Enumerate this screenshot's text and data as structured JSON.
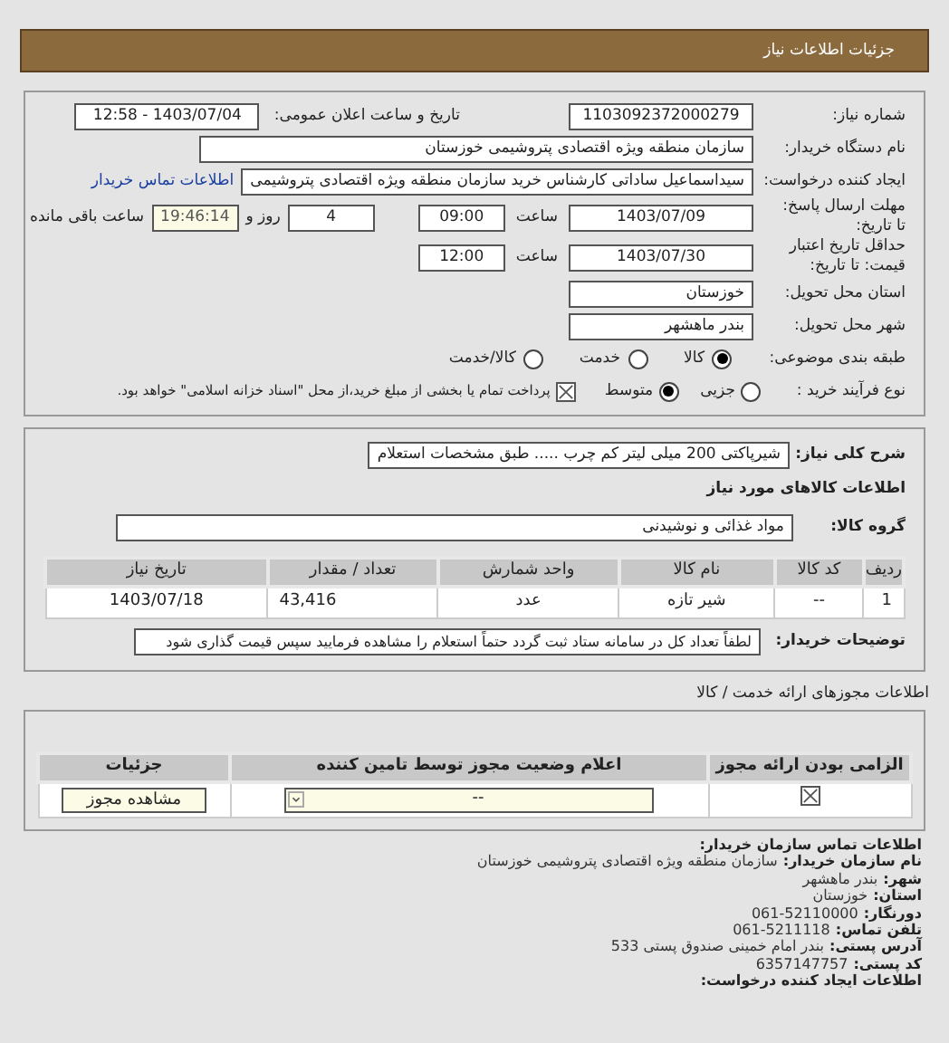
{
  "header": {
    "title": "جزئیات اطلاعات نیاز"
  },
  "need_number": {
    "label": "شماره نیاز:",
    "value": "1103092372000279"
  },
  "announce": {
    "label": "تاریخ و ساعت اعلان عمومی:",
    "value": "1403/07/04 - 12:58"
  },
  "buyer_org": {
    "label": "نام دستگاه خریدار:",
    "value": "سازمان منطقه ویژه اقتصادی پتروشیمی خوزستان"
  },
  "requester": {
    "label": "ایجاد کننده درخواست:",
    "value": "سیداسماعیل ساداتی کارشناس خرید سازمان منطقه ویژه اقتصادی پتروشیمی",
    "link": "اطلاعات تماس خریدار"
  },
  "deadline": {
    "label": "مهلت ارسال پاسخ: تا تاریخ:",
    "date": "1403/07/09",
    "time_label": "ساعت",
    "time": "09:00",
    "days": "4",
    "days_label": "روز و",
    "remaining": "19:46:14",
    "remaining_label": "ساعت باقی مانده"
  },
  "validity": {
    "label": "حداقل تاریخ اعتبار قیمت: تا تاریخ:",
    "date": "1403/07/30",
    "time_label": "ساعت",
    "time": "12:00"
  },
  "province": {
    "label": "استان محل تحویل:",
    "value": "خوزستان"
  },
  "city": {
    "label": "شهر محل تحویل:",
    "value": "بندر ماهشهر"
  },
  "category": {
    "label": "طبقه بندی موضوعی:",
    "options": [
      {
        "label": "کالا",
        "selected": true
      },
      {
        "label": "خدمت",
        "selected": false
      },
      {
        "label": "کالا/خدمت",
        "selected": false
      }
    ]
  },
  "process": {
    "label": "نوع فرآیند خرید :",
    "options": [
      {
        "label": "جزیی",
        "selected": false
      },
      {
        "label": "متوسط",
        "selected": true
      }
    ],
    "payment": {
      "checked": true,
      "text": "پرداخت تمام یا بخشی از مبلغ خرید،از محل \"اسناد خزانه اسلامی\" خواهد بود."
    }
  },
  "description": {
    "label": "شرح کلی نیاز:",
    "value": "شیرپاکتی 200 میلی لیتر کم چرب ..... طبق مشخصات استعلام"
  },
  "goods_title": "اطلاعات کالاهای مورد نیاز",
  "goods_group": {
    "label": "گروه کالا:",
    "value": "مواد غذائی و نوشیدنی"
  },
  "goods_table": {
    "columns": [
      "ردیف",
      "کد کالا",
      "نام کالا",
      "واحد شمارش",
      "تعداد / مقدار",
      "تاریخ نیاز"
    ],
    "rows": [
      [
        "1",
        "--",
        "شیر تازه",
        "عدد",
        "43,416",
        "1403/07/18"
      ]
    ]
  },
  "buyer_notes": {
    "label": "توضیحات خریدار:",
    "value": "لطفاً تعداد کل در سامانه ستاد ثبت گردد حتماً استعلام را مشاهده فرمایید سپس قیمت گذاری شود"
  },
  "license_title": "اطلاعات مجوزهای ارائه خدمت / کالا",
  "license_table": {
    "columns": [
      "الزامی بودن ارائه مجوز",
      "اعلام وضعیت مجوز توسط تامین کننده",
      "جزئیات"
    ],
    "rows": [
      {
        "required": true,
        "status": "--",
        "button": "مشاهده مجوز"
      }
    ]
  },
  "contact": {
    "title": "اطلاعات تماس سازمان خریدار:",
    "lines": [
      {
        "label": "نام سازمان خریدار:",
        "value": "سازمان منطقه ویژه اقتصادی پتروشیمی خوزستان"
      },
      {
        "label": "شهر:",
        "value": "بندر ماهشهر"
      },
      {
        "label": "استان:",
        "value": "خوزستان"
      },
      {
        "label": "دورنگار:",
        "value": "061-52110000"
      },
      {
        "label": "تلفن تماس:",
        "value": "061-5211118"
      },
      {
        "label": "آدرس پستی:",
        "value": "بندر امام خمینی صندوق پستی 533"
      },
      {
        "label": "کد پستی:",
        "value": "6357147757"
      }
    ],
    "creator_title": "اطلاعات ایجاد کننده درخواست:"
  }
}
